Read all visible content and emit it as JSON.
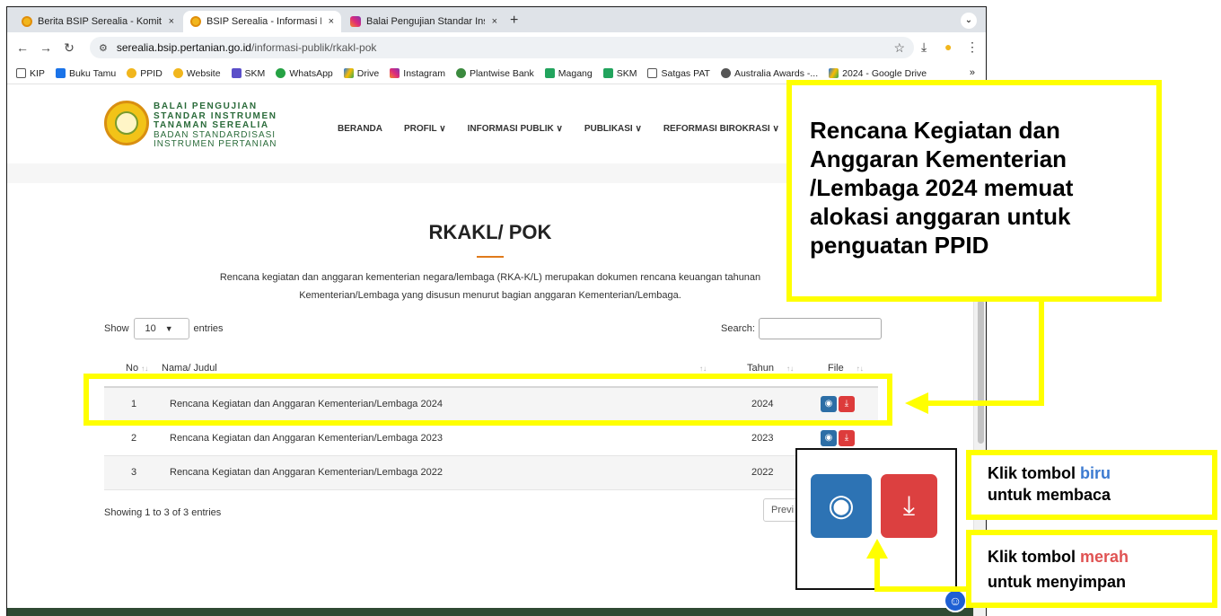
{
  "browser": {
    "tabs": [
      {
        "title": "Berita BSIP Serealia - Komitm",
        "close": "×"
      },
      {
        "title": "BSIP Serealia - Informasi Publ",
        "close": "×"
      },
      {
        "title": "Balai Pengujian Standar Instr",
        "close": "×"
      }
    ],
    "new_tab": "+",
    "tab_menu": "⌄",
    "url_domain": "serealia.bsip.pertanian.go.id",
    "url_path": "/informasi-publik/rkakl-pok",
    "bookmarks": [
      "KIP",
      "Buku Tamu",
      "PPID",
      "Website",
      "SKM",
      "WhatsApp",
      "Drive",
      "Instagram",
      "Plantwise Bank",
      "Magang",
      "SKM",
      "Satgas PAT",
      "Australia Awards -...",
      "2024 - Google Drive"
    ],
    "bookmarks_more": "»"
  },
  "site": {
    "logo": {
      "line1": "BALAI PENGUJIAN",
      "line2": "STANDAR INSTRUMEN",
      "line3": "TANAMAN SEREALIA",
      "line4": "BADAN STANDARDISASI",
      "line5": "INSTRUMEN PERTANIAN"
    },
    "nav": [
      "BERANDA",
      "PROFIL ∨",
      "INFORMASI PUBLIK ∨",
      "PUBLIKASI ∨",
      "REFORMASI BIROKRASI ∨"
    ],
    "title": "RKAKL/ POK",
    "description": "Rencana kegiatan dan anggaran kementerian negara/lembaga (RKA-K/L) merupakan dokumen rencana keuangan tahunan Kementerian/Lembaga yang disusun menurut bagian anggaran Kementerian/Lembaga.",
    "show_label": "Show",
    "entries_value": "10",
    "entries_label": "entries",
    "search_label": "Search:",
    "table": {
      "headers": {
        "no": "No",
        "title": "Nama/ Judul",
        "year": "Tahun",
        "file": "File"
      },
      "rows": [
        {
          "no": "1",
          "title": "Rencana Kegiatan dan Anggaran Kementerian/Lembaga 2024",
          "year": "2024"
        },
        {
          "no": "2",
          "title": "Rencana Kegiatan dan Anggaran Kementerian/Lembaga 2023",
          "year": "2023"
        },
        {
          "no": "3",
          "title": "Rencana Kegiatan dan Anggaran Kementerian/Lembaga 2022",
          "year": "2022"
        }
      ]
    },
    "showing": "Showing 1 to 3 of 3 entries",
    "prev": "Previ"
  },
  "annotations": {
    "callout": "Rencana Kegiatan dan Anggaran Kementerian /Lembaga 2024 memuat alokasi anggaran untuk penguatan PPID",
    "blue_label": {
      "pre": "Klik tombol ",
      "color_word": "biru",
      "post": "untuk membaca"
    },
    "red_label": {
      "pre": "Klik tombol ",
      "color_word": "merah",
      "post": "untuk menyimpan"
    }
  },
  "colors": {
    "highlight": "#ffff00",
    "view_button": "#2c6ea6",
    "download_button": "#dd3b3b",
    "accent_rule": "#e07a1b"
  }
}
